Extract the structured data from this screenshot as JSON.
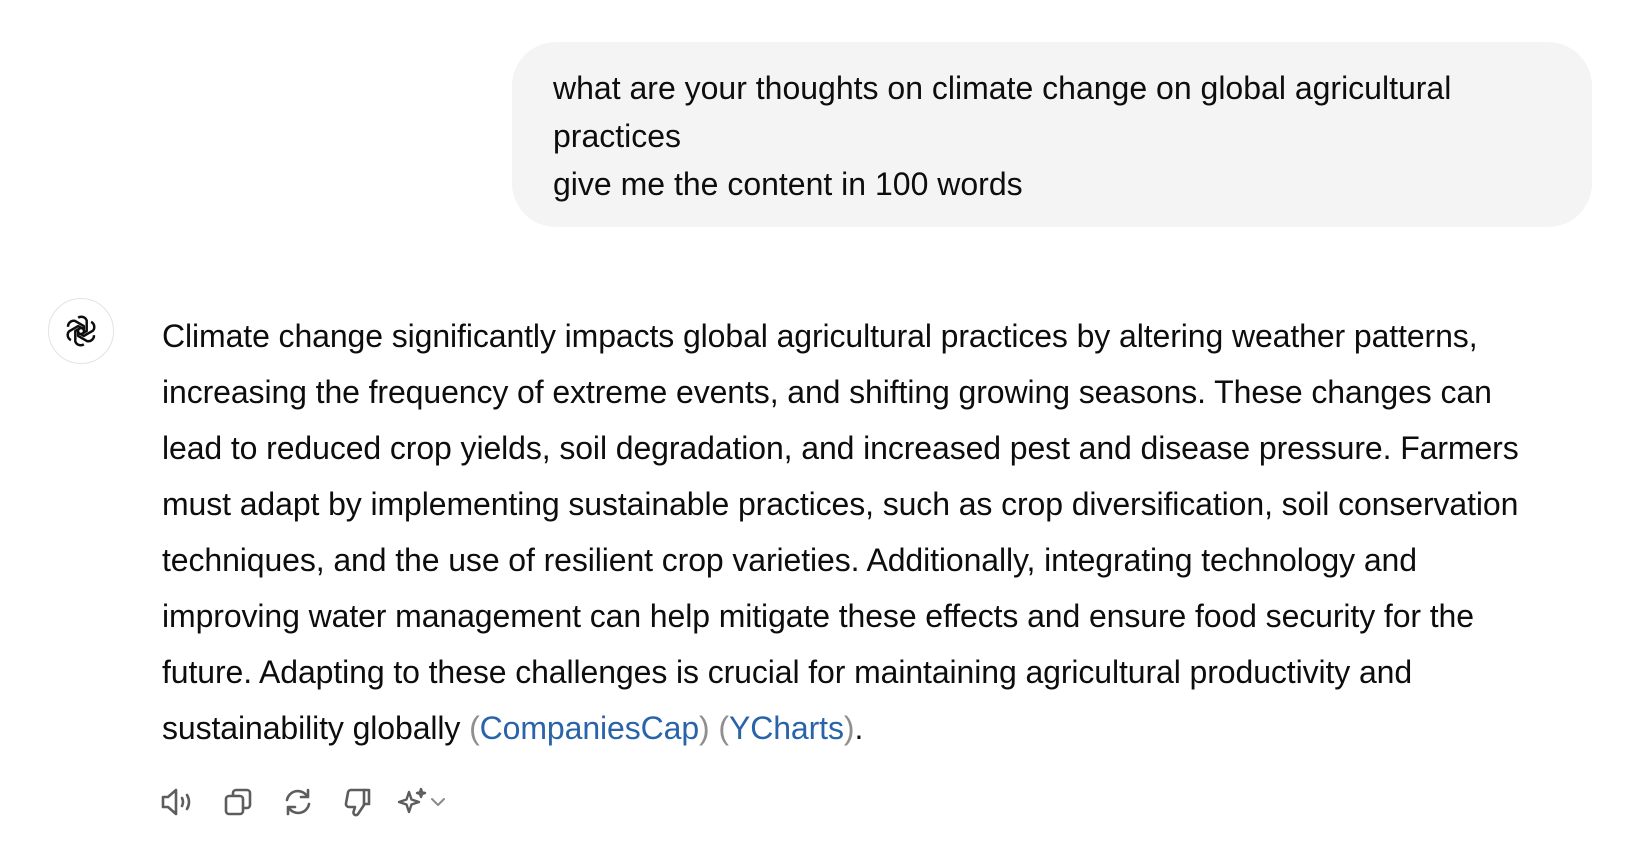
{
  "user_message": {
    "lines": [
      "what are your thoughts on climate change on global agricultural",
      "practices",
      "give me the content in 100 words"
    ]
  },
  "assistant_message": {
    "lines": [
      "Climate change significantly impacts global agricultural practices by altering weather patterns,",
      "increasing the frequency of extreme events, and shifting growing seasons. These changes can",
      "lead to reduced crop yields, soil degradation, and increased pest and disease pressure. Farmers",
      "must adapt by implementing sustainable practices, such as crop diversification, soil conservation",
      "techniques, and the use of resilient crop varieties. Additionally, integrating technology and",
      "improving water management can help mitigate these effects and ensure food security for the",
      "future. Adapting to these challenges is crucial for maintaining agricultural productivity and"
    ],
    "last_line_text": "sustainability globally ",
    "citations": [
      "CompaniesCap",
      "YCharts"
    ],
    "paren_open": "(",
    "paren_close": ")",
    "end_punct": ".",
    "avatar_icon": "openai-logo-icon"
  },
  "action_bar": {
    "icons": [
      "read-aloud-icon",
      "copy-icon",
      "regenerate-icon",
      "thumbs-down-icon",
      "sparkle-icon",
      "chevron-down-icon"
    ]
  },
  "colors": {
    "bubble_bg": "#f4f4f4",
    "text": "#0d0d0d",
    "link": "#2964aa",
    "paren": "#8f8f8f",
    "icon": "#5d5d5d"
  }
}
